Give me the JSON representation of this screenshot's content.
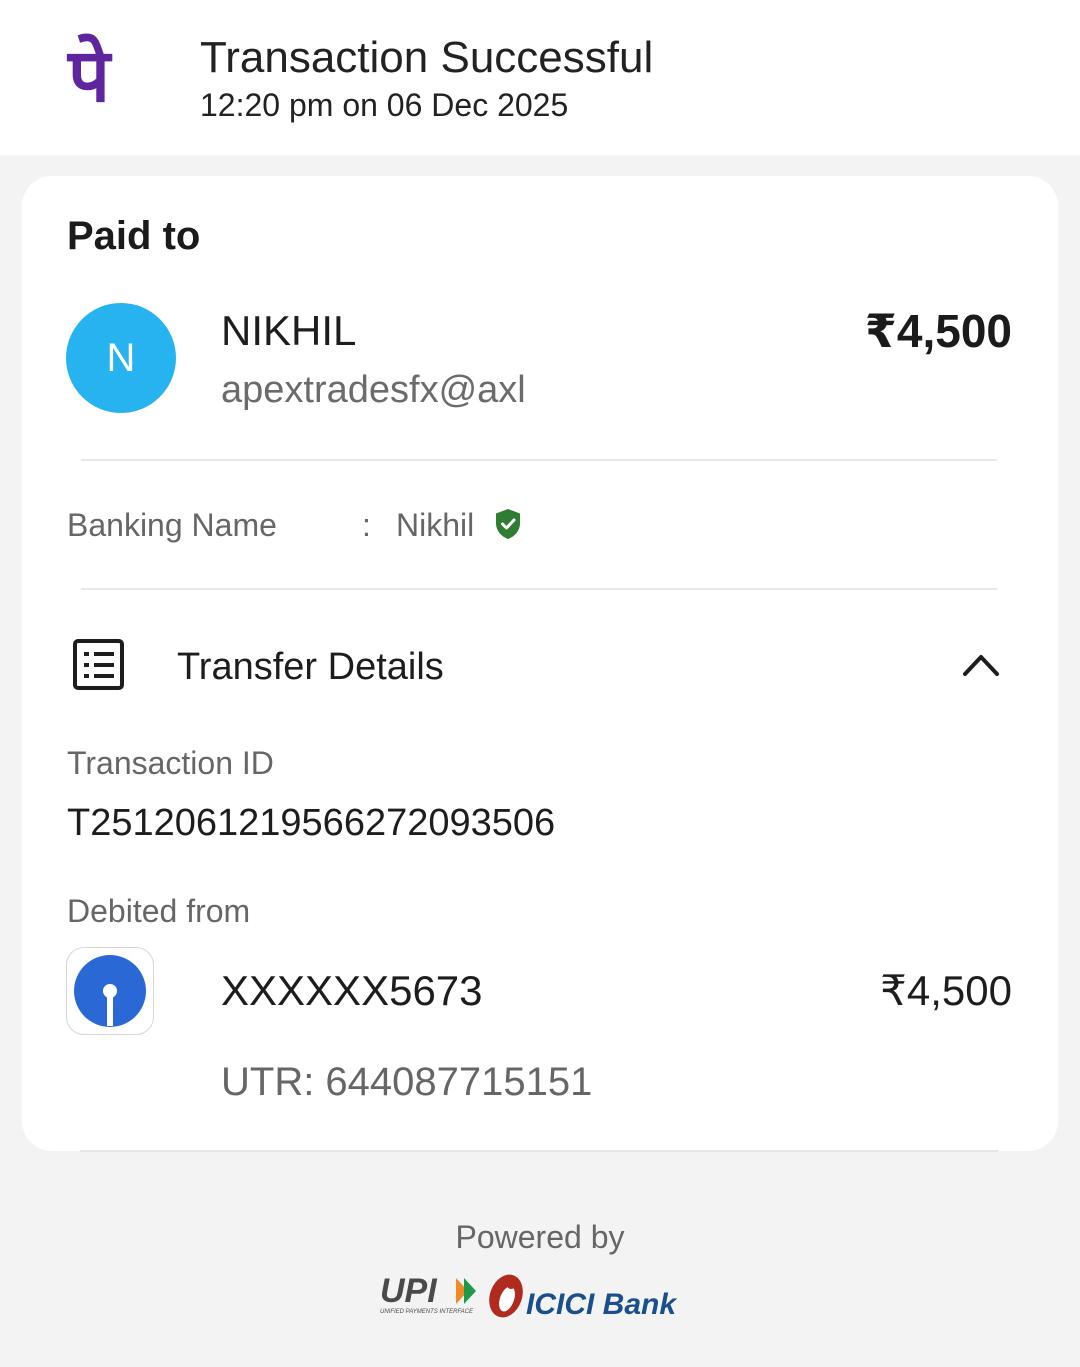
{
  "header": {
    "title": "Transaction Successful",
    "datetime": "12:20 pm on 06 Dec 2025",
    "logo_glyph": "पे",
    "brand_color": "#5f259f"
  },
  "payee": {
    "section_label": "Paid to",
    "avatar_initial": "N",
    "avatar_color": "#26b3f0",
    "name": "NIKHIL",
    "vpa": "apextradesfx@axl",
    "amount": "₹4,500"
  },
  "banking": {
    "label": "Banking Name",
    "separator": ":",
    "value": "Nikhil",
    "verified_icon": "verified-shield-icon",
    "verified_color": "#2e7d32"
  },
  "transfer": {
    "title": "Transfer Details",
    "icon": "receipt-list-icon",
    "toggle_icon": "chevron-up-icon",
    "txn_id_label": "Transaction ID",
    "txn_id": "T2512061219566272093506",
    "debited_label": "Debited from",
    "account": "XXXXXX5673",
    "amount": "₹4,500",
    "utr": "UTR: 644087715151",
    "bank_icon": "sbi-logo-icon"
  },
  "footer": {
    "powered_by": "Powered by",
    "upi_logo_text": "UPI",
    "upi_tagline": "UNIFIED PAYMENTS INTERFACE",
    "bank_logo_text": "ICICI Bank"
  }
}
